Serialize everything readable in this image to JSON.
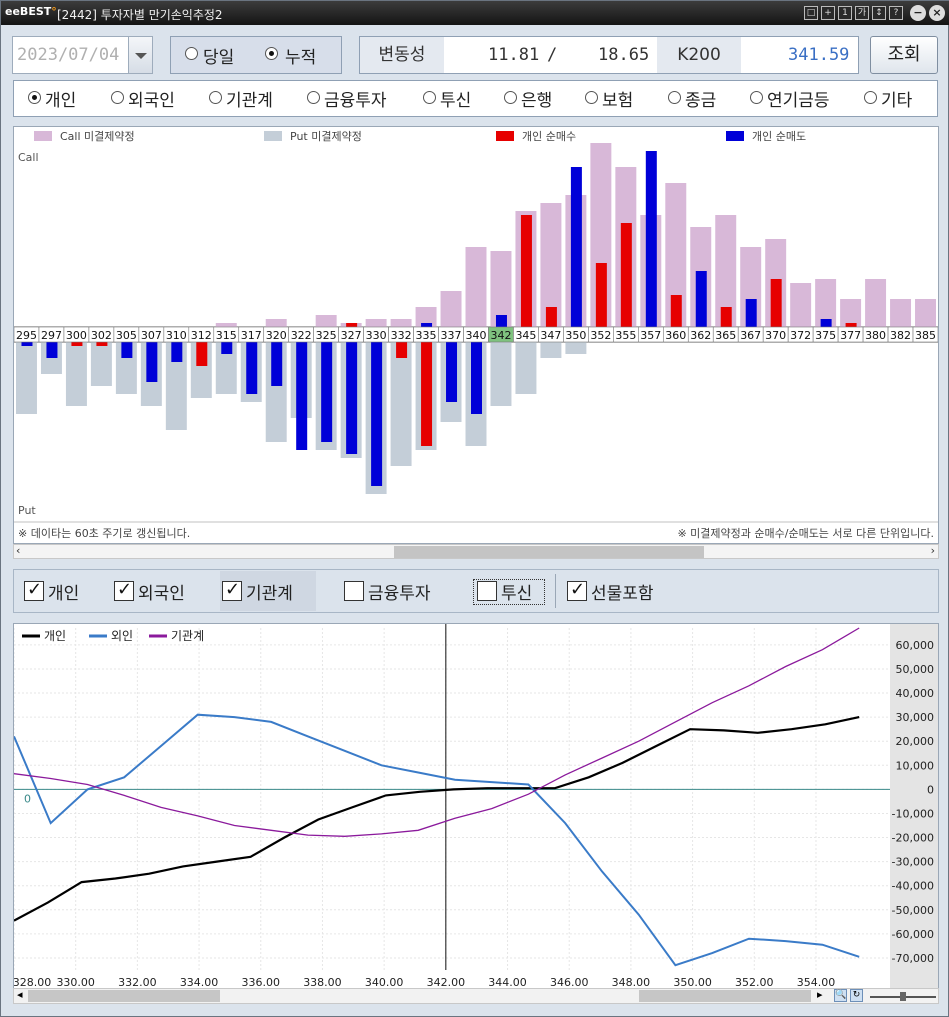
{
  "titlebar": {
    "logo": "eBEST",
    "title": "[2442] 투자자별 만기손익추정2",
    "window_buttons": [
      "□",
      "+",
      "1",
      "가",
      "↕",
      "?"
    ]
  },
  "controls": {
    "date": "2023/07/04",
    "mode_options": [
      "당일",
      "누적"
    ],
    "mode_selected": "누적",
    "volatility_label": "변동성",
    "volatility_value1": "11.81",
    "volatility_sep": "/",
    "volatility_value2": "18.65",
    "index_label": "K200",
    "index_value": "341.59",
    "search_button": "조회"
  },
  "investors": {
    "options": [
      "개인",
      "외국인",
      "기관계",
      "금융투자",
      "투신",
      "은행",
      "보험",
      "종금",
      "연기금등",
      "기타"
    ],
    "selected": "개인"
  },
  "bar_chart": {
    "legend": [
      "Call 미결제약정",
      "Put 미결제약정",
      "개인 순매수",
      "개인 순매도"
    ],
    "call_label": "Call",
    "put_label": "Put",
    "footer_left": "※ 데이타는 60초 주기로 갱신됩니다.",
    "footer_right": "※ 미결제약정과 순매수/순매도는 서로 다른 단위입니다.",
    "highlight_strike": "342",
    "colors": {
      "call_oi": "#d8b8d8",
      "put_oi": "#c4ced8",
      "buy": "#e60000",
      "sell": "#0000d8",
      "highlight": "#7fc27f"
    }
  },
  "filters": {
    "items": [
      {
        "label": "개인",
        "checked": true
      },
      {
        "label": "외국인",
        "checked": true
      },
      {
        "label": "기관계",
        "checked": true
      },
      {
        "label": "금융투자",
        "checked": false
      },
      {
        "label": "투신",
        "checked": false
      },
      {
        "label": "선물포함",
        "checked": true
      }
    ]
  },
  "chart_data": [
    {
      "type": "bar",
      "categories": [
        "295",
        "297",
        "300",
        "302",
        "305",
        "307",
        "310",
        "312",
        "315",
        "317",
        "320",
        "322",
        "325",
        "327",
        "330",
        "332",
        "335",
        "337",
        "340",
        "342",
        "345",
        "347",
        "350",
        "352",
        "355",
        "357",
        "360",
        "362",
        "365",
        "367",
        "370",
        "372",
        "375",
        "377",
        "380",
        "382",
        "385"
      ],
      "series": [
        {
          "name": "Call 미결제약정",
          "values": [
            0,
            0,
            0,
            0,
            0,
            0,
            0,
            0,
            1,
            0,
            2,
            0,
            3,
            1,
            2,
            2,
            5,
            9,
            20,
            19,
            29,
            31,
            33,
            46,
            40,
            28,
            36,
            25,
            28,
            20,
            22,
            11,
            12,
            7,
            12,
            7,
            7
          ]
        },
        {
          "name": "Put 미결제약정",
          "values": [
            -18,
            -8,
            -16,
            -11,
            -13,
            -16,
            -22,
            -14,
            -13,
            -15,
            -25,
            -19,
            -27,
            -29,
            -38,
            -31,
            -27,
            -20,
            -26,
            -16,
            -13,
            -4,
            -3,
            0,
            0,
            0,
            0,
            0,
            0,
            0,
            0,
            0,
            0,
            0,
            0,
            0,
            0
          ]
        },
        {
          "name": "개인 순매수",
          "values": [
            0,
            0,
            -1,
            -1,
            0,
            0,
            0,
            -6,
            0,
            0,
            0,
            0,
            0,
            1,
            0,
            -4,
            -26,
            0,
            0,
            0,
            28,
            5,
            0,
            16,
            26,
            0,
            8,
            0,
            5,
            0,
            12,
            0,
            0,
            1,
            0,
            0,
            0
          ]
        },
        {
          "name": "개인 순매도",
          "values": [
            -1,
            -4,
            0,
            0,
            -4,
            -10,
            -5,
            0,
            -3,
            -13,
            -11,
            -27,
            -25,
            -28,
            -36,
            0,
            1,
            -15,
            -18,
            3,
            0,
            0,
            40,
            0,
            0,
            44,
            0,
            14,
            0,
            7,
            0,
            0,
            2,
            0,
            0,
            0,
            0
          ]
        }
      ]
    },
    {
      "type": "line",
      "x": [
        328,
        329,
        330,
        331,
        332,
        333,
        334,
        335,
        336,
        337,
        338,
        339,
        340,
        341,
        342,
        343,
        344,
        345,
        346,
        347,
        348,
        349,
        350,
        351,
        352,
        353,
        354,
        355
      ],
      "series": [
        {
          "name": "개인",
          "color": "#000000",
          "values": [
            -54500,
            -47000,
            -38500,
            -37000,
            -35000,
            -32000,
            -30000,
            -28000,
            -20000,
            -12500,
            -7500,
            -2500,
            -1000,
            0,
            500,
            500,
            500,
            5000,
            11000,
            18000,
            25000,
            24500,
            23500,
            25000,
            27000,
            30000
          ]
        },
        {
          "name": "외인",
          "color": "#3a7bc8",
          "values": [
            22000,
            -14000,
            0,
            5000,
            18000,
            31000,
            30000,
            28000,
            22000,
            16000,
            10000,
            7000,
            4000,
            3000,
            2000,
            -14000,
            -34000,
            -52000,
            -73000,
            -68000,
            -62000,
            -63000,
            -64500,
            -69500
          ]
        },
        {
          "name": "기관계",
          "color": "#8b1a9c",
          "values": [
            6500,
            4500,
            2000,
            -2500,
            -7500,
            -11000,
            -15000,
            -17000,
            -19000,
            -19500,
            -18500,
            -17000,
            -12000,
            -8000,
            -2000,
            6000,
            13000,
            20000,
            28000,
            36000,
            43000,
            51000,
            58000,
            67000
          ]
        }
      ],
      "y_ticks": [
        "60,000",
        "50,000",
        "40,000",
        "30,000",
        "20,000",
        "10,000",
        "0",
        "-10,000",
        "-20,000",
        "-30,000",
        "-40,000",
        "-50,000",
        "-60,000",
        "-70,000"
      ],
      "x_ticks": [
        "328.00",
        "330.00",
        "332.00",
        "334.00",
        "336.00",
        "338.00",
        "340.00",
        "342.00",
        "344.00",
        "346.00",
        "348.00",
        "350.00",
        "352.00",
        "354.00"
      ],
      "ylim": [
        -75000,
        67000
      ],
      "zero_label": "0",
      "cursor_x": 342
    }
  ]
}
